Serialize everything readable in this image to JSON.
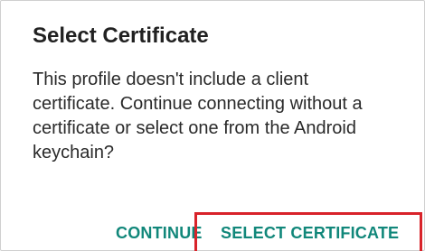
{
  "dialog": {
    "title": "Select Certificate",
    "message": "This profile doesn't include a client certificate. Continue connecting without a certificate or select one from the Android keychain?",
    "buttons": {
      "continue_label": "CONTINUE",
      "select_certificate_label": "SELECT CERTIFICATE"
    }
  },
  "colors": {
    "accent_text": "#11877a",
    "highlight_border": "#d8232a",
    "title_text": "#212121",
    "body_text": "#2a2a2a"
  }
}
